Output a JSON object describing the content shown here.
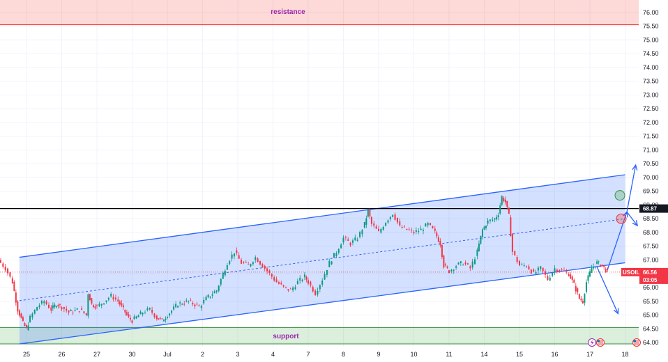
{
  "chart_data": {
    "type": "candlestick",
    "symbol": "USOIL",
    "ylim": [
      63.85,
      76.45
    ],
    "y_ticks": [
      "64.00",
      "64.50",
      "65.00",
      "65.50",
      "66.00",
      "66.50",
      "67.00",
      "67.50",
      "68.00",
      "68.50",
      "69.00",
      "69.50",
      "70.00",
      "70.50",
      "71.00",
      "71.50",
      "72.00",
      "72.50",
      "73.00",
      "73.50",
      "74.00",
      "74.50",
      "75.00",
      "75.50",
      "76.00"
    ],
    "x_ticks": [
      {
        "label": "25",
        "day": 0
      },
      {
        "label": "26",
        "day": 1
      },
      {
        "label": "27",
        "day": 2
      },
      {
        "label": "30",
        "day": 3
      },
      {
        "label": "Jul",
        "day": 4
      },
      {
        "label": "2",
        "day": 5
      },
      {
        "label": "3",
        "day": 6
      },
      {
        "label": "4",
        "day": 7
      },
      {
        "label": "7",
        "day": 8
      },
      {
        "label": "8",
        "day": 9
      },
      {
        "label": "9",
        "day": 10
      },
      {
        "label": "10",
        "day": 11
      },
      {
        "label": "11",
        "day": 12
      },
      {
        "label": "14",
        "day": 13
      },
      {
        "label": "15",
        "day": 14
      },
      {
        "label": "16",
        "day": 15
      },
      {
        "label": "17",
        "day": 16
      },
      {
        "label": "18",
        "day": 17
      }
    ],
    "price_path": [
      [
        -0.8,
        67.0
      ],
      [
        -0.6,
        66.7
      ],
      [
        -0.4,
        66.2
      ],
      [
        -0.25,
        65.2
      ],
      [
        -0.1,
        64.7
      ],
      [
        0.0,
        64.5
      ],
      [
        0.1,
        64.9
      ],
      [
        0.3,
        65.3
      ],
      [
        0.5,
        65.5
      ],
      [
        0.7,
        65.2
      ],
      [
        0.85,
        65.4
      ],
      [
        1.0,
        65.3
      ],
      [
        1.2,
        65.1
      ],
      [
        1.5,
        65.2
      ],
      [
        1.7,
        65.0
      ],
      [
        1.75,
        65.8
      ],
      [
        1.85,
        65.4
      ],
      [
        2.0,
        65.3
      ],
      [
        2.2,
        65.5
      ],
      [
        2.4,
        65.7
      ],
      [
        2.6,
        65.5
      ],
      [
        2.75,
        65.2
      ],
      [
        2.9,
        64.9
      ],
      [
        3.0,
        64.8
      ],
      [
        3.3,
        65.1
      ],
      [
        3.5,
        65.2
      ],
      [
        3.7,
        64.9
      ],
      [
        3.85,
        64.8
      ],
      [
        4.0,
        65.0
      ],
      [
        4.3,
        65.4
      ],
      [
        4.6,
        65.5
      ],
      [
        4.9,
        65.3
      ],
      [
        5.1,
        65.6
      ],
      [
        5.4,
        65.9
      ],
      [
        5.7,
        66.9
      ],
      [
        5.9,
        67.3
      ],
      [
        6.1,
        66.9
      ],
      [
        6.3,
        66.8
      ],
      [
        6.5,
        67.1
      ],
      [
        6.7,
        66.8
      ],
      [
        6.9,
        66.5
      ],
      [
        7.1,
        66.2
      ],
      [
        7.3,
        66.0
      ],
      [
        7.5,
        65.9
      ],
      [
        7.7,
        66.2
      ],
      [
        7.9,
        66.4
      ],
      [
        8.0,
        66.2
      ],
      [
        8.2,
        65.8
      ],
      [
        8.4,
        66.3
      ],
      [
        8.6,
        66.9
      ],
      [
        8.8,
        67.3
      ],
      [
        9.0,
        67.8
      ],
      [
        9.2,
        67.6
      ],
      [
        9.4,
        67.8
      ],
      [
        9.6,
        68.3
      ],
      [
        9.7,
        68.8
      ],
      [
        9.8,
        68.3
      ],
      [
        10.0,
        68.0
      ],
      [
        10.2,
        68.4
      ],
      [
        10.4,
        68.7
      ],
      [
        10.6,
        68.2
      ],
      [
        10.8,
        68.1
      ],
      [
        11.0,
        68.0
      ],
      [
        11.2,
        68.1
      ],
      [
        11.4,
        68.3
      ],
      [
        11.6,
        68.0
      ],
      [
        11.75,
        67.6
      ],
      [
        11.85,
        66.8
      ],
      [
        12.0,
        66.6
      ],
      [
        12.2,
        66.8
      ],
      [
        12.4,
        66.9
      ],
      [
        12.6,
        66.7
      ],
      [
        12.8,
        67.3
      ],
      [
        12.95,
        68.1
      ],
      [
        13.1,
        68.4
      ],
      [
        13.3,
        68.5
      ],
      [
        13.4,
        68.7
      ],
      [
        13.5,
        69.3
      ],
      [
        13.6,
        69.1
      ],
      [
        13.7,
        68.6
      ],
      [
        13.8,
        67.3
      ],
      [
        14.0,
        66.8
      ],
      [
        14.2,
        66.8
      ],
      [
        14.4,
        66.5
      ],
      [
        14.6,
        66.7
      ],
      [
        14.8,
        66.3
      ],
      [
        15.0,
        66.7
      ],
      [
        15.2,
        66.6
      ],
      [
        15.4,
        66.5
      ],
      [
        15.55,
        66.1
      ],
      [
        15.7,
        65.6
      ],
      [
        15.8,
        65.5
      ],
      [
        15.9,
        66.2
      ],
      [
        16.05,
        66.7
      ],
      [
        16.2,
        66.9
      ],
      [
        16.35,
        66.8
      ],
      [
        16.5,
        66.55
      ]
    ],
    "last_price": "66.56",
    "countdown": "03:05",
    "resistance": {
      "label": "resistance",
      "low": 75.55,
      "high": 76.45
    },
    "support": {
      "label": "support",
      "low": 63.95,
      "high": 64.55
    },
    "horizontal_level": "68.87",
    "channel": {
      "upper": [
        [
          -0.2,
          67.1
        ],
        [
          17.0,
          70.1
        ]
      ],
      "lower": [
        [
          -0.2,
          63.95
        ],
        [
          17.0,
          66.9
        ]
      ]
    }
  }
}
